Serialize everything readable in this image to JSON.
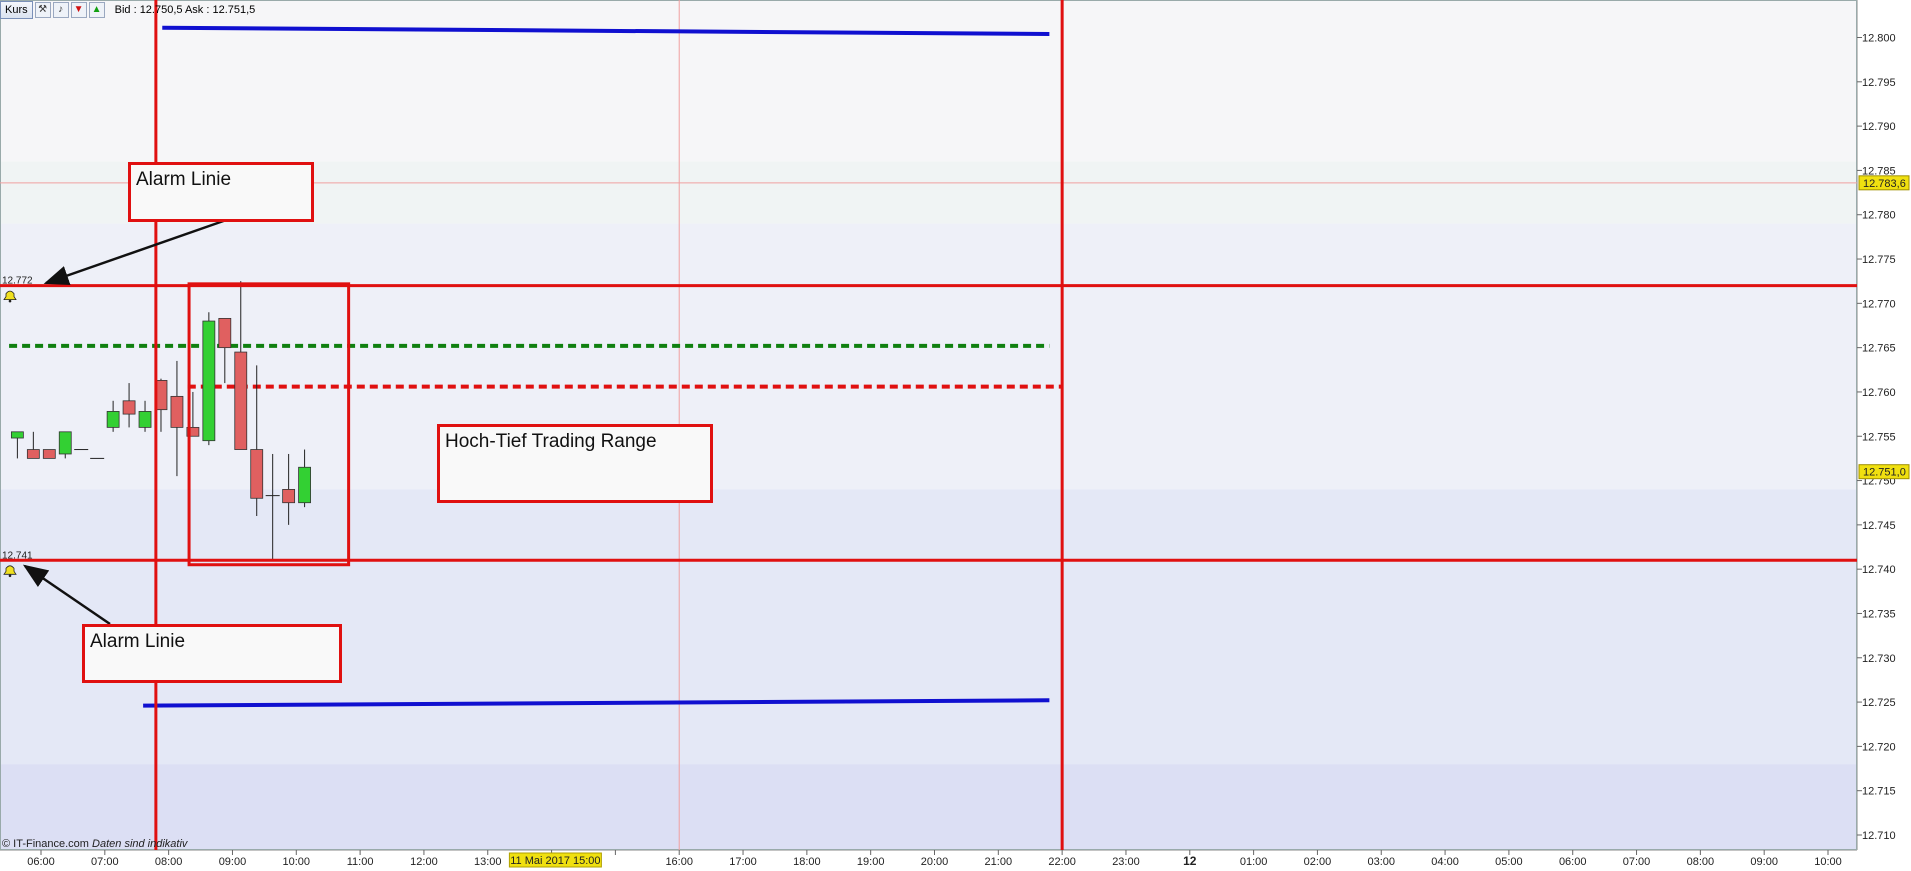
{
  "toolbar": {
    "label": "Kurs",
    "icons": [
      "wrench-icon",
      "bell-icon",
      "down-arrow-icon",
      "up-arrow-icon"
    ],
    "quote": "Bid : 12.750,5 Ask : 12.751,5"
  },
  "annotations": {
    "alarm_top": "Alarm  Linie",
    "alarm_bottom": "Alarm Linie",
    "range": "Hoch-Tief Trading Range"
  },
  "footer": {
    "source": "© IT-Finance.com",
    "note": "Daten sind indikativ"
  },
  "chart_data": {
    "type": "candlestick",
    "ylim": [
      12.708,
      12.805
    ],
    "y_ticks": [
      "12.800",
      "12.795",
      "12.790",
      "12.785",
      "12.780",
      "12.775",
      "12.770",
      "12.765",
      "12.760",
      "12.755",
      "12.750",
      "12.745",
      "12.740",
      "12.735",
      "12.730",
      "12.725",
      "12.720",
      "12.715",
      "12.710"
    ],
    "x_labels": [
      "06:00",
      "07:00",
      "08:00",
      "09:00",
      "10:00",
      "11:00",
      "12:00",
      "13:00",
      "14:00",
      "11 Mai 2017 15:00",
      "16:00",
      "17:00",
      "18:00",
      "19:00",
      "20:00",
      "21:00",
      "22:00",
      "23:00",
      "12",
      "01:00",
      "02:00",
      "03:00",
      "04:00",
      "05:00",
      "06:00",
      "07:00",
      "08:00",
      "09:00",
      "10:00"
    ],
    "x_range_hours": [
      5.5,
      34.2
    ],
    "price_tags": [
      {
        "label": "12.783,6",
        "value": 12.7836
      },
      {
        "label": "12.751,0",
        "value": 12.751
      }
    ],
    "alarm_lines": [
      {
        "label": "12.772",
        "value": 12.772
      },
      {
        "label": "12.741",
        "value": 12.741
      }
    ],
    "candles": [
      {
        "t": 5.63,
        "o": 12.7548,
        "h": 12.7555,
        "l": 12.7525,
        "c": 12.7555
      },
      {
        "t": 5.88,
        "o": 12.7535,
        "h": 12.7555,
        "l": 12.7525,
        "c": 12.7525
      },
      {
        "t": 6.13,
        "o": 12.7535,
        "h": 12.7535,
        "l": 12.7525,
        "c": 12.7525
      },
      {
        "t": 6.38,
        "o": 12.753,
        "h": 12.7555,
        "l": 12.7525,
        "c": 12.7555
      },
      {
        "t": 6.63,
        "o": 12.7535,
        "h": 12.7535,
        "l": 12.7535,
        "c": 12.7535
      },
      {
        "t": 6.88,
        "o": 12.7525,
        "h": 12.7525,
        "l": 12.7525,
        "c": 12.7525
      },
      {
        "t": 7.13,
        "o": 12.756,
        "h": 12.759,
        "l": 12.7555,
        "c": 12.7578
      },
      {
        "t": 7.38,
        "o": 12.759,
        "h": 12.761,
        "l": 12.756,
        "c": 12.7575
      },
      {
        "t": 7.63,
        "o": 12.756,
        "h": 12.759,
        "l": 12.7555,
        "c": 12.7578
      },
      {
        "t": 7.88,
        "o": 12.7613,
        "h": 12.7615,
        "l": 12.7555,
        "c": 12.758
      },
      {
        "t": 8.13,
        "o": 12.7595,
        "h": 12.7635,
        "l": 12.7505,
        "c": 12.756
      },
      {
        "t": 8.38,
        "o": 12.756,
        "h": 12.76,
        "l": 12.755,
        "c": 12.755
      },
      {
        "t": 8.63,
        "o": 12.7545,
        "h": 12.769,
        "l": 12.754,
        "c": 12.768
      },
      {
        "t": 8.88,
        "o": 12.7683,
        "h": 12.7683,
        "l": 12.761,
        "c": 12.765
      },
      {
        "t": 9.13,
        "o": 12.7645,
        "h": 12.7725,
        "l": 12.7535,
        "c": 12.7535
      },
      {
        "t": 9.38,
        "o": 12.7535,
        "h": 12.763,
        "l": 12.746,
        "c": 12.748
      },
      {
        "t": 9.63,
        "o": 12.7483,
        "h": 12.753,
        "l": 12.741,
        "c": 12.7483
      },
      {
        "t": 9.88,
        "o": 12.749,
        "h": 12.753,
        "l": 12.745,
        "c": 12.7475
      },
      {
        "t": 10.13,
        "o": 12.7475,
        "h": 12.7535,
        "l": 12.747,
        "c": 12.7515
      }
    ],
    "blue_lines": [
      {
        "t1": 7.9,
        "v1": 12.8011,
        "t2": 21.8,
        "v2": 12.8004
      },
      {
        "t1": 7.6,
        "v1": 12.7246,
        "t2": 21.8,
        "v2": 12.7252
      }
    ],
    "green_dashed": {
      "t1": 5.5,
      "t2": 21.8,
      "value": 12.7652
    },
    "red_dashed": {
      "t1": 8.3,
      "t2": 22.0,
      "value": 12.7606
    },
    "vertical_lines": [
      7.8,
      22.0
    ],
    "thin_vertical_lines": [
      16.0
    ],
    "thin_horizontal_value": 12.7836,
    "range_box": {
      "t1": 8.32,
      "t2": 10.82,
      "v1": 12.7722,
      "v2": 12.7405
    },
    "colors": {
      "bull": "#33d033",
      "bear": "#e06060",
      "alarm": "#e01010",
      "blue_line": "#1010d0",
      "green_line": "#108010",
      "date_tag": "#f0e010",
      "price_tag": "#f0e010"
    }
  }
}
